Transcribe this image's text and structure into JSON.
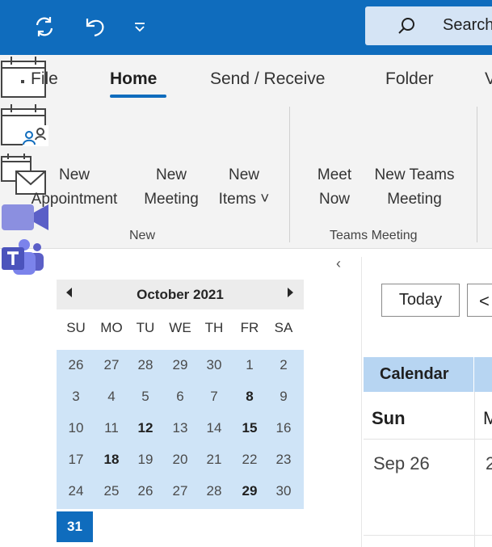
{
  "ribbon_tabs": [
    {
      "label": "File",
      "active": false
    },
    {
      "label": "Home",
      "active": true
    },
    {
      "label": "Send / Receive",
      "active": false
    },
    {
      "label": "Folder",
      "active": false
    },
    {
      "label": "V",
      "active": false
    }
  ],
  "search": {
    "label": "Search"
  },
  "new_group": {
    "label": "New",
    "buttons": [
      {
        "line1": "New",
        "line2": "Appointment"
      },
      {
        "line1": "New",
        "line2": "Meeting"
      },
      {
        "line1": "New",
        "line2": "Items ˅"
      }
    ]
  },
  "teams_group": {
    "label": "Teams Meeting",
    "buttons": [
      {
        "line1": "Meet",
        "line2": "Now"
      },
      {
        "line1": "New Teams",
        "line2": "Meeting"
      }
    ]
  },
  "collapse_glyph": "‹",
  "date_navigator": {
    "month_label": "October 2021",
    "weekdays": [
      "SU",
      "MO",
      "TU",
      "WE",
      "TH",
      "FR",
      "SA"
    ],
    "weeks": [
      [
        {
          "d": "26"
        },
        {
          "d": "27"
        },
        {
          "d": "28"
        },
        {
          "d": "29"
        },
        {
          "d": "30"
        },
        {
          "d": "1"
        },
        {
          "d": "2"
        }
      ],
      [
        {
          "d": "3"
        },
        {
          "d": "4"
        },
        {
          "d": "5"
        },
        {
          "d": "6"
        },
        {
          "d": "7"
        },
        {
          "d": "8",
          "bold": true
        },
        {
          "d": "9"
        }
      ],
      [
        {
          "d": "10"
        },
        {
          "d": "11"
        },
        {
          "d": "12",
          "bold": true
        },
        {
          "d": "13"
        },
        {
          "d": "14"
        },
        {
          "d": "15",
          "bold": true
        },
        {
          "d": "16"
        }
      ],
      [
        {
          "d": "17"
        },
        {
          "d": "18",
          "bold": true
        },
        {
          "d": "19"
        },
        {
          "d": "20"
        },
        {
          "d": "21"
        },
        {
          "d": "22"
        },
        {
          "d": "23"
        }
      ],
      [
        {
          "d": "24"
        },
        {
          "d": "25"
        },
        {
          "d": "26"
        },
        {
          "d": "27"
        },
        {
          "d": "28"
        },
        {
          "d": "29",
          "bold": true
        },
        {
          "d": "30"
        }
      ]
    ],
    "today": "31"
  },
  "calendar_view": {
    "today_button": "Today",
    "prev_glyph": "<",
    "header_label": "Calendar",
    "columns": [
      {
        "day": "Sun",
        "date": "Sep 26"
      },
      {
        "day": "M",
        "date": "2"
      }
    ]
  },
  "colors": {
    "accent": "#0f6cbd",
    "calendar_selection": "#cfe4f7",
    "calendar_header": "#b7d5f2",
    "teams_purple": "#5b5fc7",
    "meet_now_purple": "#8b8fe0"
  }
}
